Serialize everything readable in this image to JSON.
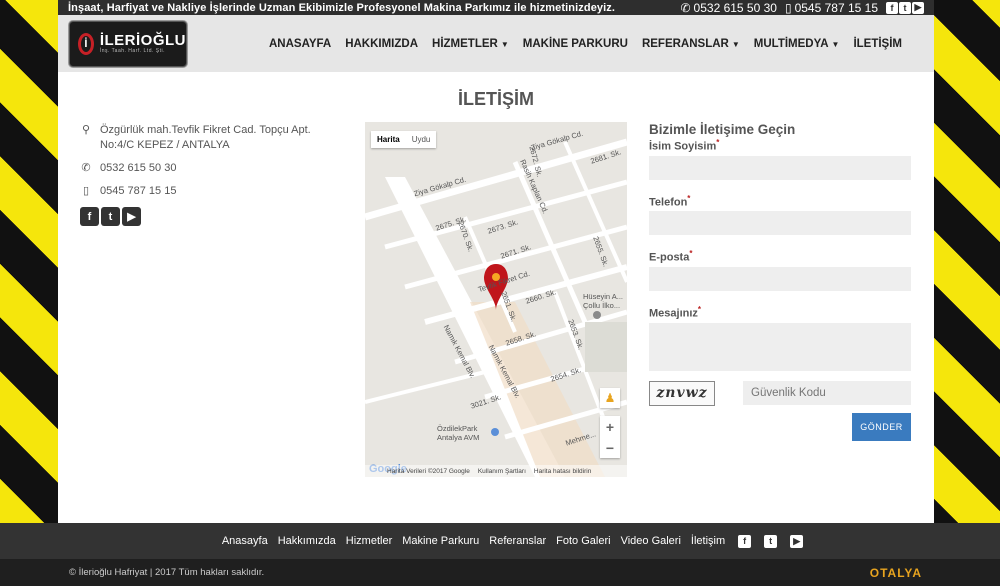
{
  "topbar": {
    "slogan": "İnşaat, Harfiyat ve Nakliye İşlerinde Uzman Ekibimizle Profesyonel Makina Parkımız ile hizmetinizdeyiz.",
    "phone1": "0532 615 50 30",
    "phone2": "0545 787 15 15"
  },
  "logo": {
    "name": "İLERİOĞLU",
    "tagline": "İnş. Taah. Harf. Ltd. Şti."
  },
  "nav": {
    "items": [
      "ANASAYFA",
      "HAKKIMIZDA",
      "HİZMETLER",
      "MAKİNE PARKURU",
      "REFERANSLAR",
      "MULTİMEDYA",
      "İLETİŞİM"
    ]
  },
  "page": {
    "title": "İLETİŞİM"
  },
  "contact": {
    "address": "Özgürlük mah.Tevfik Fikret Cad. Topçu Apt. No:4/C KEPEZ / ANTALYA",
    "phone1": "0532 615 50 30",
    "phone2": "0545 787 15 15"
  },
  "map": {
    "type_map": "Harita",
    "type_satellite": "Uydu",
    "zoom_in": "+",
    "zoom_out": "−",
    "logo": "Google",
    "data_credit": "Harita Verileri ©2017 Google",
    "terms": "Kullanım Şartları",
    "report": "Harita hatası bildirin",
    "labels": {
      "l1": "Ziya Gökalp Cd.",
      "l2": "Ziya Gökalp Cd.",
      "l3": "Rasih Kaplan Cd.",
      "l4": "2675. Sk.",
      "l5": "2673. Sk.",
      "l6": "2671. Sk.",
      "l7": "Tevfik Fikret Cd.",
      "l8": "2660. Sk.",
      "l9": "2658. Sk.",
      "l10": "Namık Kemal Blv.",
      "l11": "Namık Kemal Blv.",
      "l12": "3021. Sk.",
      "l13": "ÖzdilekPark Antalya AVM",
      "l14": "Hüseyin A... Çollu İlko...",
      "l15": "2672. Sk.",
      "l16": "2681. Sk.",
      "l17": "2655. Sk.",
      "l18": "2653. Sk.",
      "l19": "2654. Sk.",
      "l20": "2651. Sk.",
      "l21": "2670. Sk.",
      "l22": "Mehme..."
    }
  },
  "form": {
    "heading": "Bizimle İletişime Geçin",
    "name_label": "İsim Soyisim",
    "phone_label": "Telefon",
    "email_label": "E-posta",
    "message_label": "Mesajınız",
    "required_mark": "*",
    "captcha_text": "znvwz",
    "captcha_placeholder": "Güvenlik Kodu",
    "submit_label": "GÖNDER"
  },
  "footer": {
    "links": [
      "Anasayfa",
      "Hakkımızda",
      "Hizmetler",
      "Makine Parkuru",
      "Referanslar",
      "Foto Galeri",
      "Video Galeri",
      "İletişim"
    ],
    "copyright": "© İlerioğlu Hafriyat | 2017 Tüm hakları saklıdır.",
    "brand": "OTALYA"
  },
  "colors": {
    "accent_button": "#3a7bbf",
    "marker": "#c0151b",
    "brand": "#e8a41f"
  },
  "icons": {
    "location": "map-marker-icon",
    "phone": "phone-icon",
    "mobile": "mobile-icon",
    "facebook": "facebook-icon",
    "twitter": "twitter-icon",
    "youtube": "youtube-icon"
  }
}
